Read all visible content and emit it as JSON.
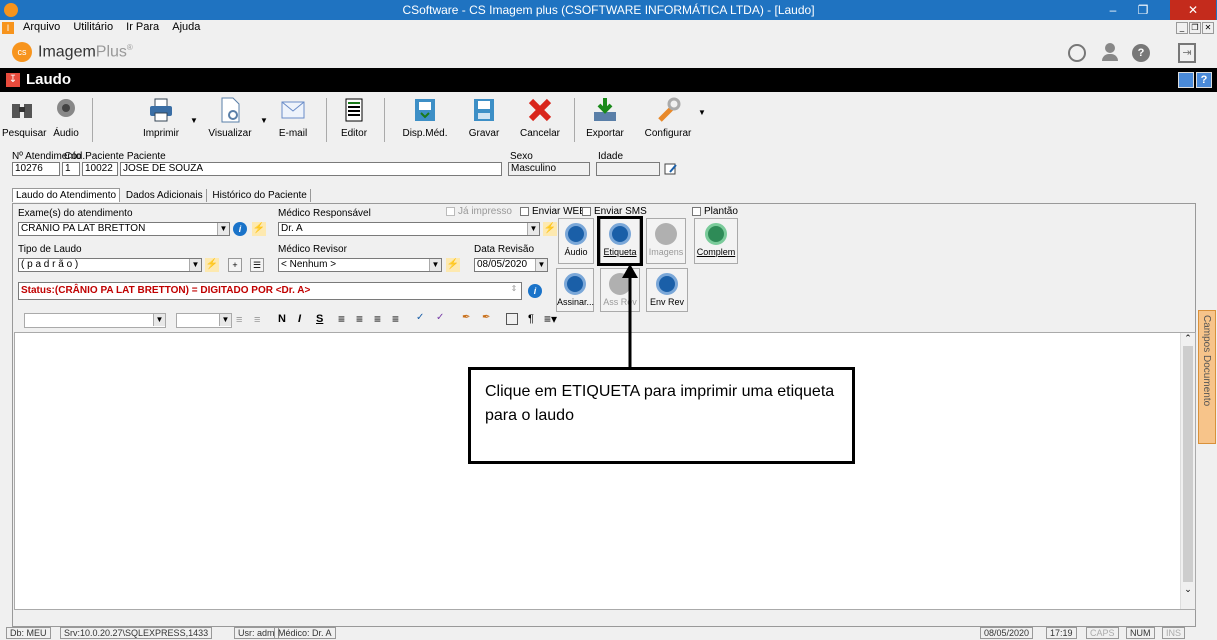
{
  "window": {
    "title": "CSoftware - CS Imagem plus (CSOFTWARE INFORMÁTICA LTDA) - [Laudo]"
  },
  "menu": [
    "Arquivo",
    "Utilitário",
    "Ir Para",
    "Ajuda"
  ],
  "brand": {
    "name_a": "Imagem",
    "name_b": "Plus",
    "reg": "®"
  },
  "form_title": "Laudo",
  "toolbar": [
    {
      "label": "Pesquisar",
      "icon": "binoculars-icon"
    },
    {
      "label": "Áudio",
      "icon": "speaker-icon"
    },
    {
      "label": "Imprimir",
      "icon": "printer-icon"
    },
    {
      "label": "Visualizar",
      "icon": "preview-icon"
    },
    {
      "label": "E-mail",
      "icon": "envelope-icon"
    },
    {
      "label": "Editor",
      "icon": "editor-icon"
    },
    {
      "label": "Disp.Méd.",
      "icon": "dispose-icon"
    },
    {
      "label": "Gravar",
      "icon": "save-icon"
    },
    {
      "label": "Cancelar",
      "icon": "cancel-icon"
    },
    {
      "label": "Exportar",
      "icon": "export-icon"
    },
    {
      "label": "Configurar",
      "icon": "wrench-icon"
    }
  ],
  "patient": {
    "atendimento_label": "Nº Atendimento",
    "atendimento": "10276",
    "cod_label": "Cód.Paciente Paciente",
    "seq": "1",
    "cod": "10022",
    "nome": "JOSE DE SOUZA",
    "sexo_label": "Sexo",
    "sexo": "Masculino",
    "idade_label": "Idade",
    "idade": ""
  },
  "tabs": [
    "Laudo do Atendimento",
    "Dados Adicionais",
    "Histórico do Paciente"
  ],
  "checks": {
    "ja_impresso": "Já impresso",
    "enviar_web": "Enviar WEB",
    "enviar_sms": "Enviar SMS",
    "plantao": "Plantão"
  },
  "exam": {
    "exames_label": "Exame(s) do atendimento",
    "exame": "CRÂNIO PA LAT BRETTON",
    "medico_resp_label": "Médico Responsável",
    "medico_resp": "Dr. A",
    "tipo_label": "Tipo de Laudo",
    "tipo": "( p a d r ã o )",
    "medico_rev_label": "Médico Revisor",
    "medico_rev": "< Nenhum >",
    "data_rev_label": "Data Revisão",
    "data_rev": "08/05/2020",
    "status": "Status:(CRÂNIO PA LAT BRETTON) = DIGITADO POR <Dr. A>"
  },
  "side_buttons": {
    "audio": "Áudio",
    "etiqueta": "Etiqueta",
    "imagens": "Imagens",
    "complem": "Complem",
    "assinar": "Assinar...",
    "ass_rev": "Ass Rev",
    "env_rev": "Env Rev"
  },
  "format_toolbar": {
    "bold": "N",
    "italic": "I",
    "underline": "S",
    "para": "¶"
  },
  "callout": "Clique em ETIQUETA para imprimir uma etiqueta para o laudo",
  "right_panel": "Campos Documento",
  "statusbar": {
    "db": "Db: MEU",
    "srv": "Srv:10.0.20.27\\SQLEXPRESS,1433",
    "usr": "Usr: adm",
    "medico": "Médico: Dr. A",
    "date": "08/05/2020",
    "time": "17:19",
    "caps": "CAPS",
    "num": "NUM",
    "ins": "INS"
  }
}
